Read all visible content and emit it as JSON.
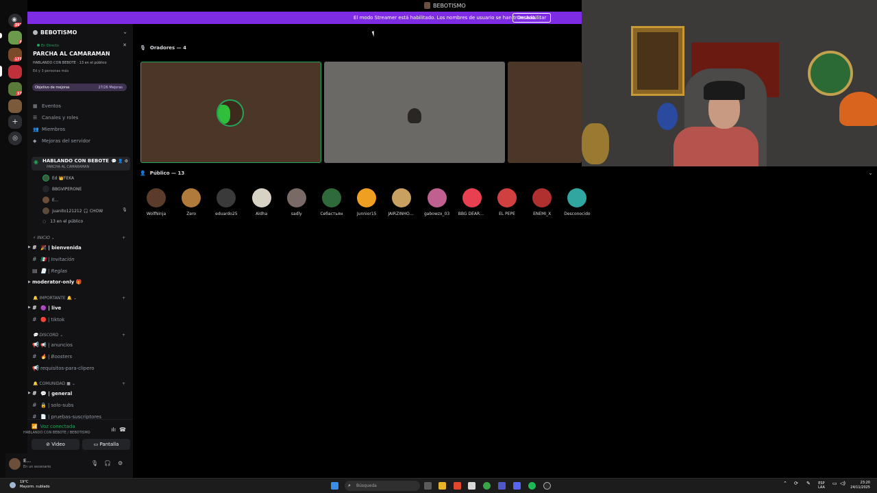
{
  "window": {
    "title": "BEBOTISMO"
  },
  "banner": {
    "message": "El modo Streamer está habilitado. Los nombres de usuario se han truncado.",
    "button": "Deshabilitar"
  },
  "rail": {
    "badges": [
      "397",
      "8",
      "171",
      "17"
    ]
  },
  "server": {
    "name": "BEBOTISMO"
  },
  "event": {
    "status": "En Directo",
    "title": "PARCHA AL CAMARAMAN",
    "subtitle": "HABLANDO CON BEBOTE · 13 en el público",
    "participants": "Ed y 3 personas más"
  },
  "boost": {
    "label": "Objetivo de mejoras",
    "value": "27/26 Mejoras"
  },
  "menu": [
    {
      "label": "Eventos",
      "icon": "calendar-icon"
    },
    {
      "label": "Canales y roles",
      "icon": "channels-icon"
    },
    {
      "label": "Miembros",
      "icon": "members-icon"
    },
    {
      "label": "Mejoras del servidor",
      "icon": "boost-icon"
    }
  ],
  "voice_channel": {
    "name": "HABLANDO CON BEBOTE",
    "topic": "PARCHA AL CAMARAMAN"
  },
  "voice_users": [
    {
      "name": "Ed 👑FEKA"
    },
    {
      "name": "BBGVIPERONE"
    },
    {
      "name": "E..."
    },
    {
      "name": "juanito121212 🎧 CHOW"
    }
  ],
  "audience_count": "13 en el público",
  "categories": {
    "inicio": "INICIO",
    "importante": "IMPORTANTE 🔔",
    "discord": "DISCORD",
    "comunidad": "COMUNIDAD ■"
  },
  "channels": {
    "bienvenida": "| bienvenida",
    "invitacion": "| Invitación",
    "reglas": "| Reglas",
    "moderator": "moderator-only 🎁",
    "live": "| live",
    "tiktok": "| tiktok",
    "anuncios": "| anuncios",
    "boosters": "| Boosters",
    "requisitos": "requisitos-para-clipero",
    "general": "| general",
    "solosubs": "| solo-subs",
    "pruebas": "| pruebas-suscriptores"
  },
  "live_mentions": "166",
  "voice_footer": {
    "status": "Voz conectada",
    "channel": "HABLANDO CON BEBOTE / BEBOTISMO",
    "video": "Video",
    "screen": "Pantalla"
  },
  "user": {
    "name": "E...",
    "status": "En un escenario"
  },
  "stage": {
    "speakers_header": "Oradores — 4",
    "audience_header": "Público — 13"
  },
  "audience": [
    {
      "name": "WolfNinja",
      "color": "#5b3b2a"
    },
    {
      "name": "Zero",
      "color": "#b07a3a"
    },
    {
      "name": "eduardo25",
      "color": "#3a3a3a"
    },
    {
      "name": "Aldha",
      "color": "#d8d2c4"
    },
    {
      "name": "sadly",
      "color": "#7a6a66"
    },
    {
      "name": "Себастьян",
      "color": "#2f6a3a"
    },
    {
      "name": "Junnior15",
      "color": "#f0a020"
    },
    {
      "name": "JAIRZINHOcU...",
      "color": "#c8a060"
    },
    {
      "name": "gabowzx_03",
      "color": "#c06090"
    },
    {
      "name": "BBG DEARCR...",
      "color": "#e84050"
    },
    {
      "name": "EL PEPE",
      "color": "#d04040"
    },
    {
      "name": "ENEMI_X",
      "color": "#b03030"
    },
    {
      "name": "Desconocido",
      "color": "#2fa6a0"
    }
  ],
  "taskbar": {
    "temp": "19°C",
    "weather": "Mayorm. nublado",
    "search": "Búsqueda",
    "lang1": "ESP",
    "lang2": "LAA",
    "time": "23:20",
    "date": "24/11/2025"
  }
}
